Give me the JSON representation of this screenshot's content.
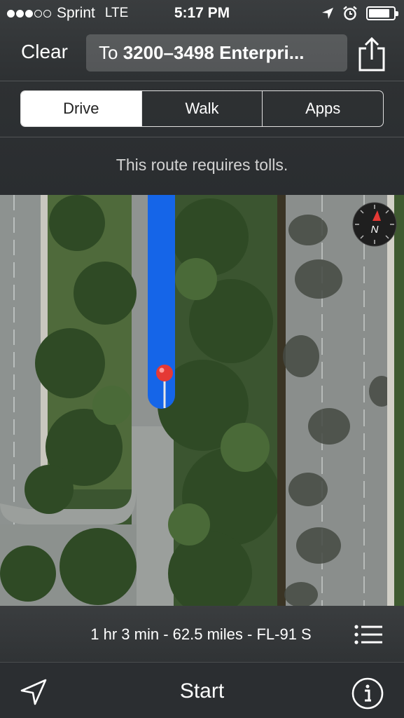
{
  "status_bar": {
    "signal_bars_full": 3,
    "signal_bars_total": 5,
    "carrier": "Sprint",
    "network": "LTE",
    "time": "5:17 PM",
    "battery_level": 0.85
  },
  "nav": {
    "clear_label": "Clear",
    "destination_prefix": "To",
    "destination_address": "3200–3498 Enterpri..."
  },
  "transport_tabs": [
    {
      "label": "Drive",
      "selected": true
    },
    {
      "label": "Walk",
      "selected": false
    },
    {
      "label": "Apps",
      "selected": false
    }
  ],
  "notice": "This route requires tolls.",
  "map": {
    "compass_label": "N",
    "route_color": "#1565e8",
    "pin_color": "#e53935"
  },
  "route": {
    "summary": "1 hr 3 min - 62.5 miles - FL-91 S"
  },
  "toolbar": {
    "start_label": "Start"
  },
  "icons": [
    "location-arrow-icon",
    "alarm-clock-icon",
    "share-icon",
    "list-icon",
    "info-icon",
    "compass-icon",
    "map-pin-icon"
  ]
}
